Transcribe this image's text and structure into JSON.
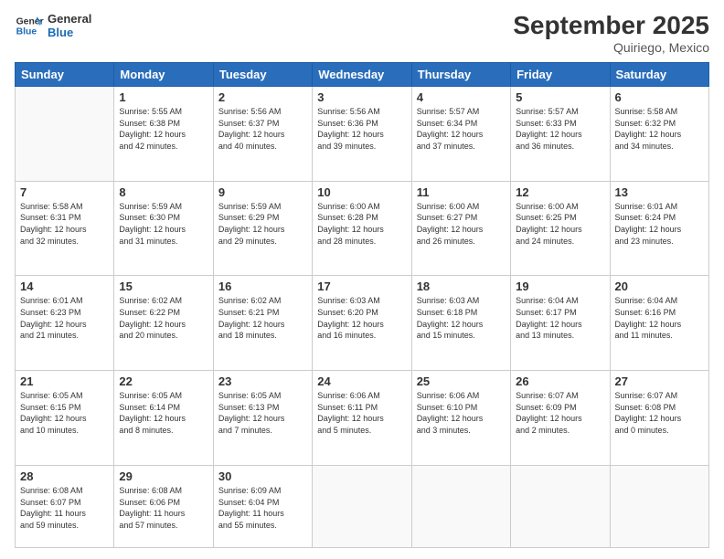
{
  "header": {
    "logo_line1": "General",
    "logo_line2": "Blue",
    "month": "September 2025",
    "location": "Quiriego, Mexico"
  },
  "weekdays": [
    "Sunday",
    "Monday",
    "Tuesday",
    "Wednesday",
    "Thursday",
    "Friday",
    "Saturday"
  ],
  "weeks": [
    [
      {
        "day": "",
        "info": ""
      },
      {
        "day": "1",
        "info": "Sunrise: 5:55 AM\nSunset: 6:38 PM\nDaylight: 12 hours\nand 42 minutes."
      },
      {
        "day": "2",
        "info": "Sunrise: 5:56 AM\nSunset: 6:37 PM\nDaylight: 12 hours\nand 40 minutes."
      },
      {
        "day": "3",
        "info": "Sunrise: 5:56 AM\nSunset: 6:36 PM\nDaylight: 12 hours\nand 39 minutes."
      },
      {
        "day": "4",
        "info": "Sunrise: 5:57 AM\nSunset: 6:34 PM\nDaylight: 12 hours\nand 37 minutes."
      },
      {
        "day": "5",
        "info": "Sunrise: 5:57 AM\nSunset: 6:33 PM\nDaylight: 12 hours\nand 36 minutes."
      },
      {
        "day": "6",
        "info": "Sunrise: 5:58 AM\nSunset: 6:32 PM\nDaylight: 12 hours\nand 34 minutes."
      }
    ],
    [
      {
        "day": "7",
        "info": "Sunrise: 5:58 AM\nSunset: 6:31 PM\nDaylight: 12 hours\nand 32 minutes."
      },
      {
        "day": "8",
        "info": "Sunrise: 5:59 AM\nSunset: 6:30 PM\nDaylight: 12 hours\nand 31 minutes."
      },
      {
        "day": "9",
        "info": "Sunrise: 5:59 AM\nSunset: 6:29 PM\nDaylight: 12 hours\nand 29 minutes."
      },
      {
        "day": "10",
        "info": "Sunrise: 6:00 AM\nSunset: 6:28 PM\nDaylight: 12 hours\nand 28 minutes."
      },
      {
        "day": "11",
        "info": "Sunrise: 6:00 AM\nSunset: 6:27 PM\nDaylight: 12 hours\nand 26 minutes."
      },
      {
        "day": "12",
        "info": "Sunrise: 6:00 AM\nSunset: 6:25 PM\nDaylight: 12 hours\nand 24 minutes."
      },
      {
        "day": "13",
        "info": "Sunrise: 6:01 AM\nSunset: 6:24 PM\nDaylight: 12 hours\nand 23 minutes."
      }
    ],
    [
      {
        "day": "14",
        "info": "Sunrise: 6:01 AM\nSunset: 6:23 PM\nDaylight: 12 hours\nand 21 minutes."
      },
      {
        "day": "15",
        "info": "Sunrise: 6:02 AM\nSunset: 6:22 PM\nDaylight: 12 hours\nand 20 minutes."
      },
      {
        "day": "16",
        "info": "Sunrise: 6:02 AM\nSunset: 6:21 PM\nDaylight: 12 hours\nand 18 minutes."
      },
      {
        "day": "17",
        "info": "Sunrise: 6:03 AM\nSunset: 6:20 PM\nDaylight: 12 hours\nand 16 minutes."
      },
      {
        "day": "18",
        "info": "Sunrise: 6:03 AM\nSunset: 6:18 PM\nDaylight: 12 hours\nand 15 minutes."
      },
      {
        "day": "19",
        "info": "Sunrise: 6:04 AM\nSunset: 6:17 PM\nDaylight: 12 hours\nand 13 minutes."
      },
      {
        "day": "20",
        "info": "Sunrise: 6:04 AM\nSunset: 6:16 PM\nDaylight: 12 hours\nand 11 minutes."
      }
    ],
    [
      {
        "day": "21",
        "info": "Sunrise: 6:05 AM\nSunset: 6:15 PM\nDaylight: 12 hours\nand 10 minutes."
      },
      {
        "day": "22",
        "info": "Sunrise: 6:05 AM\nSunset: 6:14 PM\nDaylight: 12 hours\nand 8 minutes."
      },
      {
        "day": "23",
        "info": "Sunrise: 6:05 AM\nSunset: 6:13 PM\nDaylight: 12 hours\nand 7 minutes."
      },
      {
        "day": "24",
        "info": "Sunrise: 6:06 AM\nSunset: 6:11 PM\nDaylight: 12 hours\nand 5 minutes."
      },
      {
        "day": "25",
        "info": "Sunrise: 6:06 AM\nSunset: 6:10 PM\nDaylight: 12 hours\nand 3 minutes."
      },
      {
        "day": "26",
        "info": "Sunrise: 6:07 AM\nSunset: 6:09 PM\nDaylight: 12 hours\nand 2 minutes."
      },
      {
        "day": "27",
        "info": "Sunrise: 6:07 AM\nSunset: 6:08 PM\nDaylight: 12 hours\nand 0 minutes."
      }
    ],
    [
      {
        "day": "28",
        "info": "Sunrise: 6:08 AM\nSunset: 6:07 PM\nDaylight: 11 hours\nand 59 minutes."
      },
      {
        "day": "29",
        "info": "Sunrise: 6:08 AM\nSunset: 6:06 PM\nDaylight: 11 hours\nand 57 minutes."
      },
      {
        "day": "30",
        "info": "Sunrise: 6:09 AM\nSunset: 6:04 PM\nDaylight: 11 hours\nand 55 minutes."
      },
      {
        "day": "",
        "info": ""
      },
      {
        "day": "",
        "info": ""
      },
      {
        "day": "",
        "info": ""
      },
      {
        "day": "",
        "info": ""
      }
    ]
  ]
}
